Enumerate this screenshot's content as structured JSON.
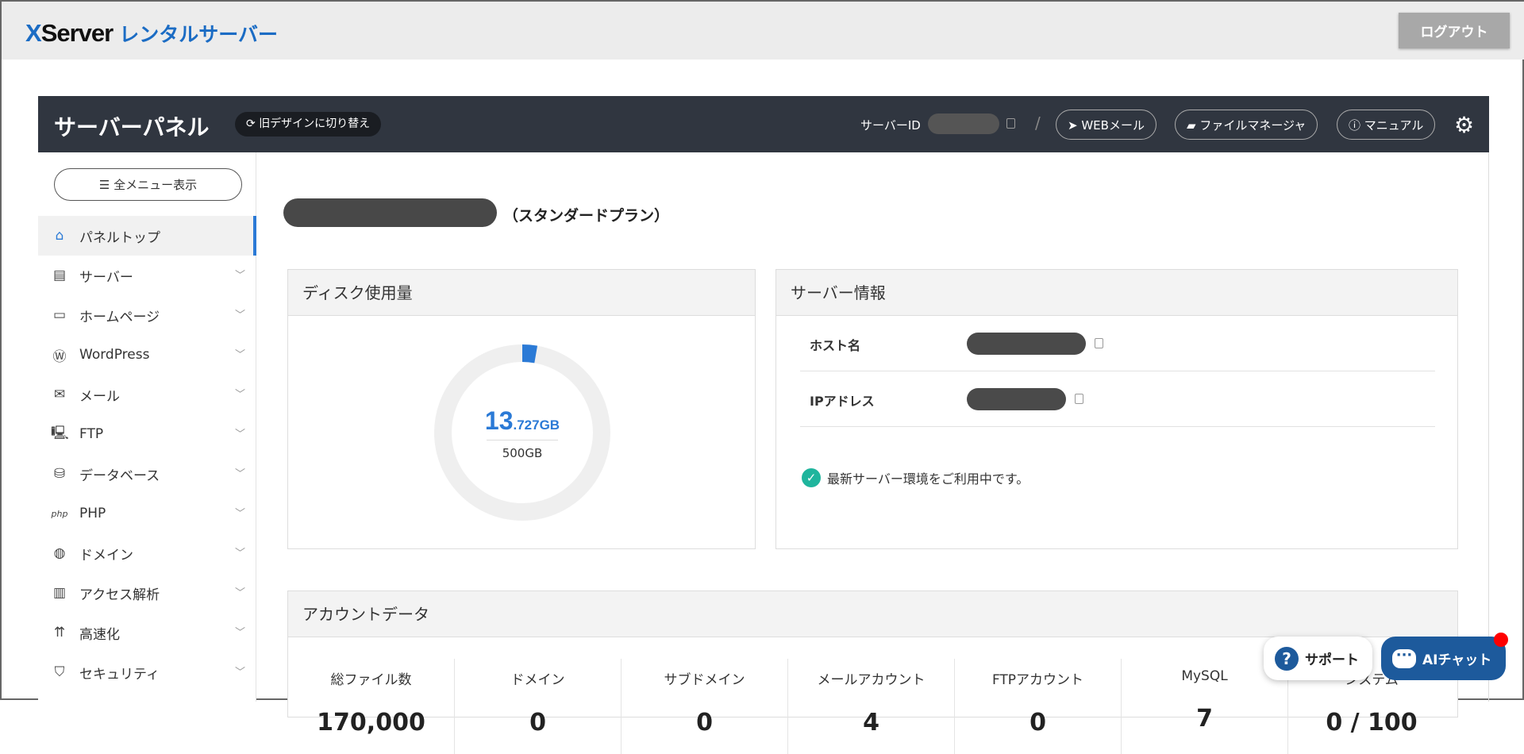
{
  "brand": {
    "logo_en": "XServer",
    "logo_jp": "レンタルサーバー"
  },
  "header": {
    "logout": "ログアウト"
  },
  "panel": {
    "title": "サーバーパネル",
    "old_design": "旧デザインに切り替え",
    "server_id_label": "サーバーID",
    "links": {
      "webmail": "WEBメール",
      "file_manager": "ファイルマネージャ",
      "manual": "マニュアル"
    }
  },
  "sidebar": {
    "all_menu": "全メニュー表示",
    "items": [
      {
        "label": "パネルトップ",
        "icon": "home-icon"
      },
      {
        "label": "サーバー",
        "icon": "server-icon"
      },
      {
        "label": "ホームページ",
        "icon": "browser-icon"
      },
      {
        "label": "WordPress",
        "icon": "wordpress-icon"
      },
      {
        "label": "メール",
        "icon": "mail-icon"
      },
      {
        "label": "FTP",
        "icon": "ftp-icon"
      },
      {
        "label": "データベース",
        "icon": "database-icon"
      },
      {
        "label": "PHP",
        "icon": "php-icon"
      },
      {
        "label": "ドメイン",
        "icon": "globe-icon"
      },
      {
        "label": "アクセス解析",
        "icon": "chart-icon"
      },
      {
        "label": "高速化",
        "icon": "speed-icon"
      },
      {
        "label": "セキュリティ",
        "icon": "shield-icon"
      }
    ]
  },
  "main": {
    "plan": "（スタンダードプラン）",
    "disk": {
      "title": "ディスク使用量",
      "used_int": "13",
      "used_dec": ".727GB",
      "total": "500GB",
      "used_fraction": 0.02745
    },
    "server_info": {
      "title": "サーバー情報",
      "host_label": "ホスト名",
      "ip_label": "IPアドレス",
      "status": "最新サーバー環境をご利用中です。"
    },
    "account": {
      "title": "アカウントデータ",
      "stats": [
        {
          "label": "総ファイル数",
          "value": "170,000"
        },
        {
          "label": "ドメイン",
          "value": "0"
        },
        {
          "label": "サブドメイン",
          "value": "0"
        },
        {
          "label": "メールアカウント",
          "value": "4"
        },
        {
          "label": "FTPアカウント",
          "value": "0"
        },
        {
          "label": "MySQL",
          "value": "7"
        },
        {
          "label": "システム",
          "value": "0 / 100"
        }
      ]
    }
  },
  "floating": {
    "support": "サポート",
    "ai_chat": "AIチャット"
  },
  "colors": {
    "accent": "#2b7ad6",
    "panel_bar": "#303640",
    "chat": "#1d5a9c"
  }
}
